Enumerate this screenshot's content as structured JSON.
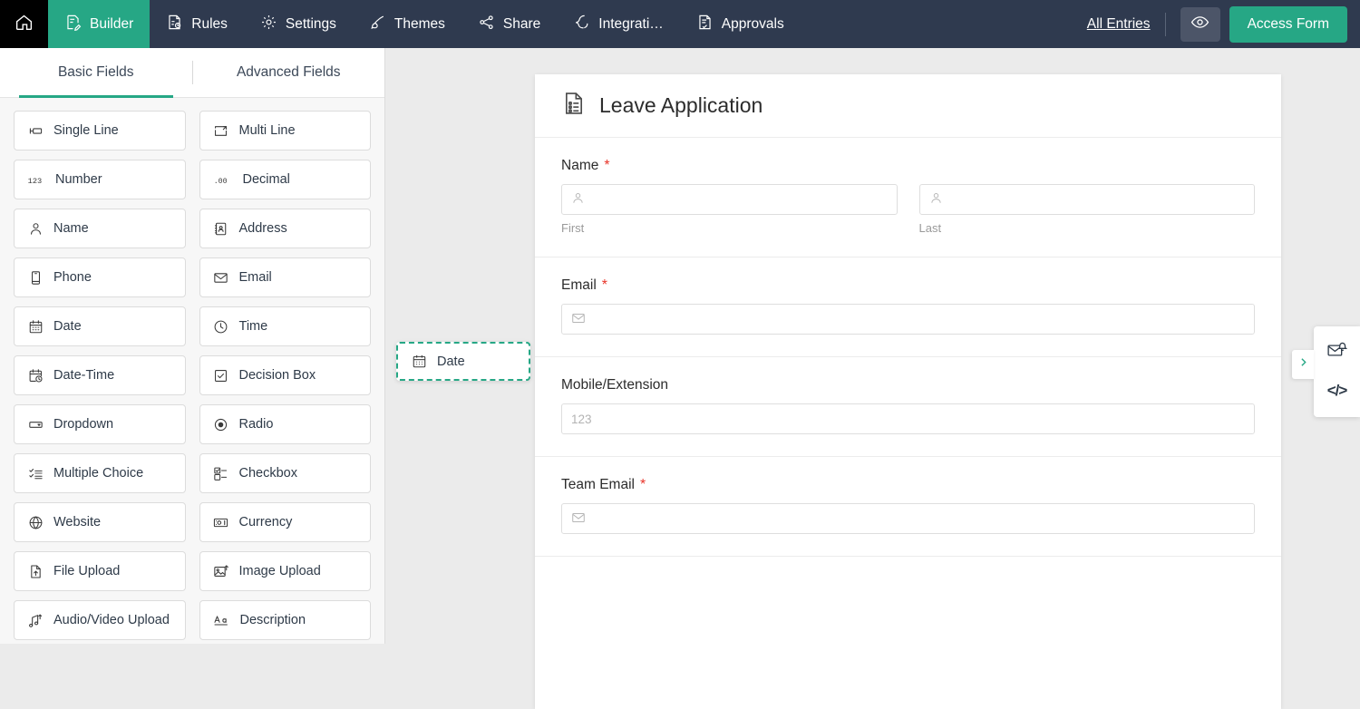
{
  "theme": {
    "navbar_bg": "#2f3a4f",
    "accent_green": "#26a785",
    "home_bg": "#000000",
    "canvas_bg": "#ebebeb",
    "required_red": "#e8352a"
  },
  "topnav": {
    "home_icon": "home-icon",
    "items": [
      {
        "label": "Builder",
        "icon": "builder-icon",
        "active": true
      },
      {
        "label": "Rules",
        "icon": "rules-icon",
        "active": false
      },
      {
        "label": "Settings",
        "icon": "gear-icon",
        "active": false
      },
      {
        "label": "Themes",
        "icon": "brush-icon",
        "active": false
      },
      {
        "label": "Share",
        "icon": "share-icon",
        "active": false
      },
      {
        "label": "Integrati…",
        "icon": "integrations-icon",
        "active": false
      },
      {
        "label": "Approvals",
        "icon": "approvals-icon",
        "active": false
      }
    ],
    "all_entries_label": "All Entries",
    "preview_icon": "eye-icon",
    "access_form_label": "Access Form"
  },
  "sidebar": {
    "tabs": [
      {
        "label": "Basic Fields",
        "active": true
      },
      {
        "label": "Advanced Fields",
        "active": false
      }
    ],
    "fields": [
      {
        "label": "Single Line",
        "icon": "single-line-icon"
      },
      {
        "label": "Multi Line",
        "icon": "multi-line-icon"
      },
      {
        "label": "Number",
        "icon": "number-icon"
      },
      {
        "label": "Decimal",
        "icon": "decimal-icon"
      },
      {
        "label": "Name",
        "icon": "person-icon"
      },
      {
        "label": "Address",
        "icon": "address-book-icon"
      },
      {
        "label": "Phone",
        "icon": "phone-icon"
      },
      {
        "label": "Email",
        "icon": "envelope-icon"
      },
      {
        "label": "Date",
        "icon": "calendar-icon"
      },
      {
        "label": "Time",
        "icon": "clock-icon"
      },
      {
        "label": "Date-Time",
        "icon": "calendar-clock-icon"
      },
      {
        "label": "Decision Box",
        "icon": "checkbox-square-icon"
      },
      {
        "label": "Dropdown",
        "icon": "dropdown-icon"
      },
      {
        "label": "Radio",
        "icon": "radio-icon"
      },
      {
        "label": "Multiple Choice",
        "icon": "multiple-choice-icon"
      },
      {
        "label": "Checkbox",
        "icon": "checkbox-list-icon"
      },
      {
        "label": "Website",
        "icon": "globe-icon"
      },
      {
        "label": "Currency",
        "icon": "currency-icon"
      },
      {
        "label": "File Upload",
        "icon": "file-upload-icon"
      },
      {
        "label": "Image Upload",
        "icon": "image-upload-icon"
      },
      {
        "label": "Audio/Video Upload",
        "icon": "av-upload-icon"
      },
      {
        "label": "Description",
        "icon": "text-format-icon"
      }
    ]
  },
  "canvas": {
    "dragging_field": {
      "label": "Date",
      "icon": "calendar-icon"
    },
    "form": {
      "title": "Leave Application",
      "title_icon": "form-document-icon",
      "rows": [
        {
          "label": "Name",
          "required": true,
          "type": "name",
          "parts": [
            {
              "sublabel": "First",
              "icon": "person-icon",
              "value": ""
            },
            {
              "sublabel": "Last",
              "icon": "person-icon",
              "value": ""
            }
          ]
        },
        {
          "label": "Email",
          "required": true,
          "type": "email",
          "icon": "envelope-icon",
          "value": "",
          "placeholder": ""
        },
        {
          "label": "Mobile/Extension",
          "required": false,
          "type": "number",
          "icon": "",
          "value": "",
          "placeholder": "123"
        },
        {
          "label": "Team Email",
          "required": true,
          "type": "email",
          "icon": "envelope-icon",
          "value": "",
          "placeholder": ""
        }
      ]
    },
    "side_panel": {
      "toggle_icon": "chevron-right-icon",
      "buttons": [
        {
          "icon": "notification-email-icon",
          "label": ""
        },
        {
          "icon": "code-icon",
          "label": "</>"
        }
      ]
    }
  }
}
